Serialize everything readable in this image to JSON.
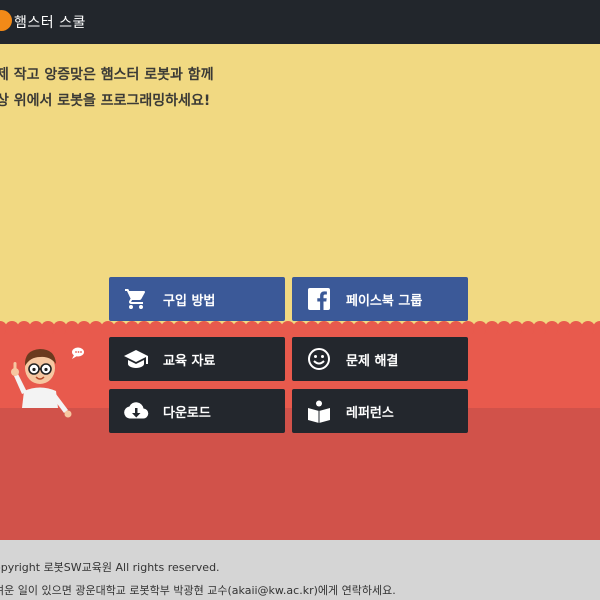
{
  "header": {
    "logo_text": "햄스터 스쿨"
  },
  "hero": {
    "line1": "제 작고 앙증맞은 햄스터 로봇과 함께",
    "line2": "상 위에서 로봇을 프로그래밍하세요!"
  },
  "buttons": {
    "purchase": {
      "label": "구입 방법",
      "icon": "cart-icon"
    },
    "facebook": {
      "label": "페이스북 그룹",
      "icon": "facebook-icon"
    },
    "education": {
      "label": "교육 자료",
      "icon": "graduation-cap-icon"
    },
    "troubleshoot": {
      "label": "문제 해결",
      "icon": "smiley-icon"
    },
    "download": {
      "label": "다운로드",
      "icon": "cloud-download-icon"
    },
    "reference": {
      "label": "레퍼런스",
      "icon": "reading-book-icon"
    }
  },
  "footer": {
    "copyright": "opyright 로봇SW교육원 All rights reserved.",
    "contact": "려운 일이 있으면 광운대학교 로봇학부 박광현 교수(akaii@kw.ac.kr)에게 연락하세요."
  },
  "colors": {
    "topbar": "#22262c",
    "hero_bg": "#f1d982",
    "red_band": "#e85a4d",
    "red_band_low": "#d1524a",
    "facebook_blue": "#3b5998",
    "dark_button": "#23272d",
    "footer_bg": "#d5d5d5",
    "logo_orange": "#f28a18"
  }
}
